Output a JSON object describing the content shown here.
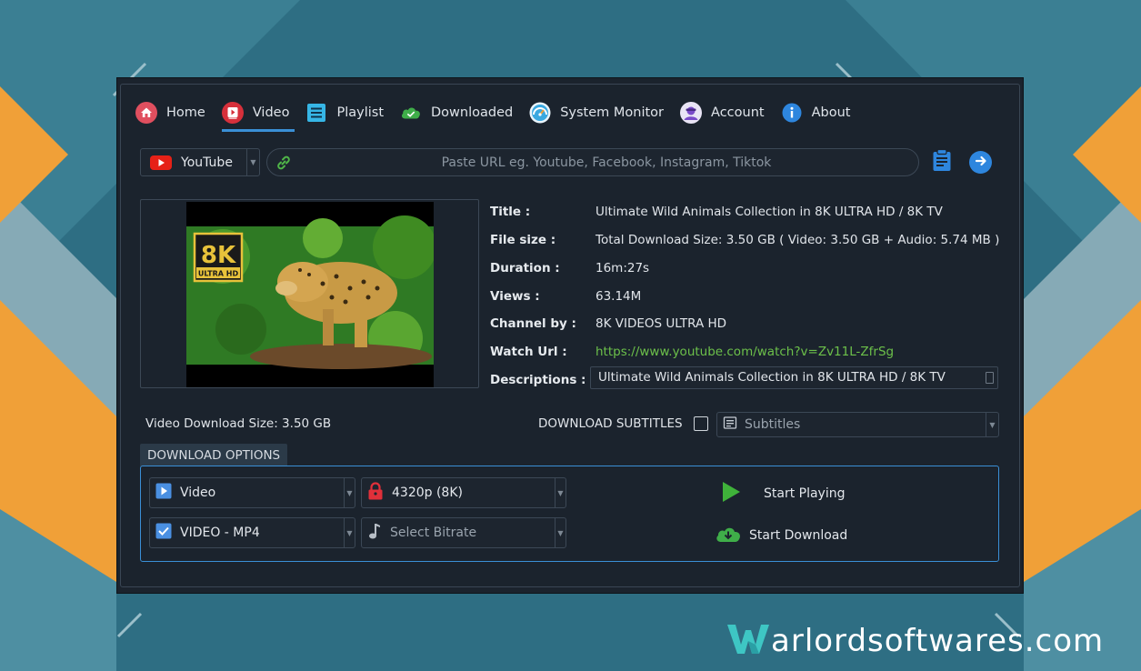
{
  "nav": [
    {
      "label": "Home",
      "icon": "home-icon",
      "active": false
    },
    {
      "label": "Video",
      "icon": "video-icon",
      "active": true
    },
    {
      "label": "Playlist",
      "icon": "playlist-icon",
      "active": false
    },
    {
      "label": "Downloaded",
      "icon": "cloud-icon",
      "active": false
    },
    {
      "label": "System Monitor",
      "icon": "gauge-icon",
      "active": false
    },
    {
      "label": "Account",
      "icon": "user-icon",
      "active": false
    },
    {
      "label": "About",
      "icon": "info-icon",
      "active": false
    }
  ],
  "source": {
    "label": "YouTube",
    "icon": "youtube-icon"
  },
  "url": {
    "placeholder": "Paste URL eg. Youtube, Facebook, Instagram, Tiktok",
    "value": ""
  },
  "thumbnail": {
    "badge_top": "8K",
    "badge_bottom": "ULTRA HD"
  },
  "info": {
    "title_key": "Title :",
    "title_val": "Ultimate Wild Animals Collection in 8K ULTRA HD / 8K TV",
    "size_key": "File size :",
    "size_val": "Total Download Size: 3.50 GB  ( Video: 3.50 GB + Audio: 5.74 MB )",
    "duration_key": "Duration :",
    "duration_val": "16m:27s",
    "views_key": "Views :",
    "views_val": "63.14M",
    "channel_key": "Channel by :",
    "channel_val": "8K VIDEOS ULTRA HD",
    "url_key": "Watch Url :",
    "url_val": "https://www.youtube.com/watch?v=Zv11L-ZfrSg",
    "desc_key": "Descriptions :",
    "desc_val": "Ultimate Wild Animals Collection in 8K ULTRA HD / 8K TV"
  },
  "download_size": "Video Download Size: 3.50 GB",
  "subtitles": {
    "label": "DOWNLOAD SUBTITLES",
    "checked": false,
    "select": "Subtitles"
  },
  "options": {
    "tab_label": "DOWNLOAD OPTIONS",
    "type": "Video",
    "resolution": "4320p (8K)",
    "format": "VIDEO - MP4",
    "bitrate": "Select Bitrate"
  },
  "actions": {
    "play": "Start Playing",
    "download": "Start Download"
  },
  "watermark": {
    "letter": "W",
    "text": "arlordsoftwares.com"
  },
  "colors": {
    "accent": "#3a8fd6",
    "link": "#6cc04a",
    "play": "#3fb23a",
    "window": "#1b232d"
  }
}
